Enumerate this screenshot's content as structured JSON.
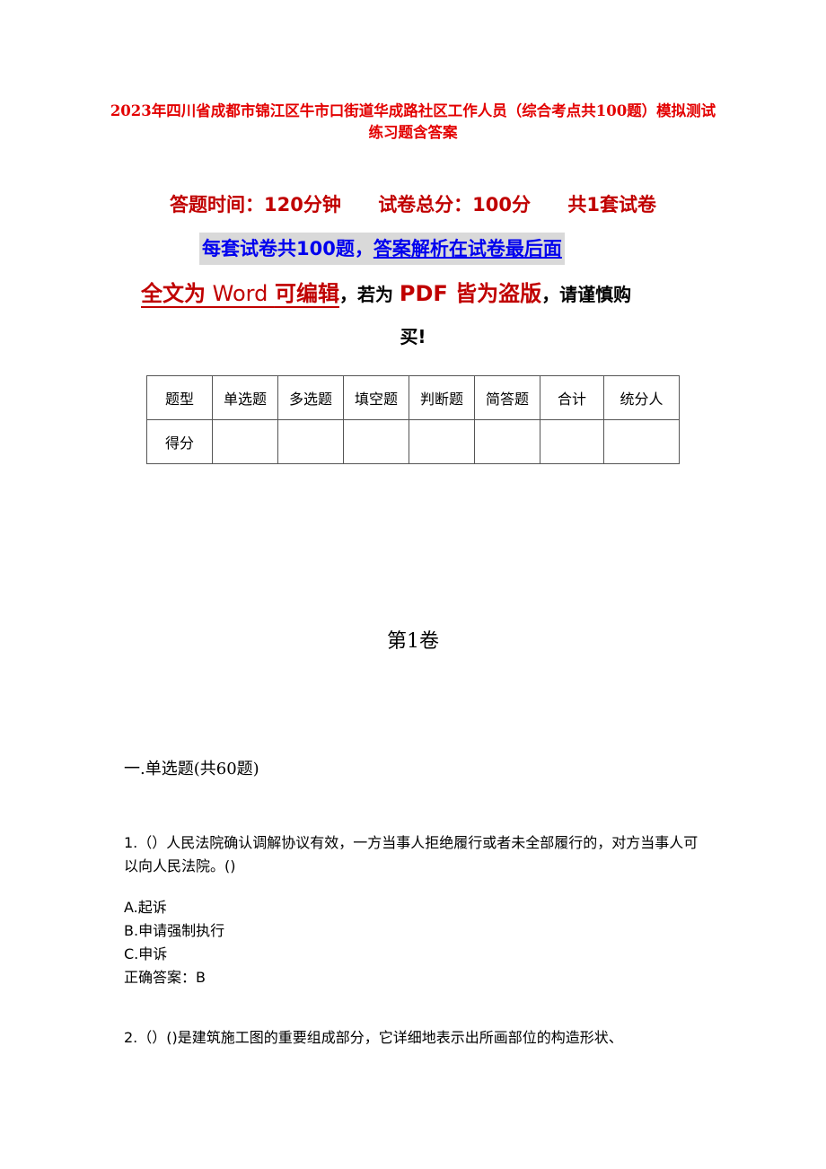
{
  "document": {
    "title": "2023年四川省成都市锦江区牛市口街道华成路社区工作人员（综合考点共100题）模拟测试练习题含答案",
    "meta": {
      "time": "答题时间：120分钟",
      "total_score": "试卷总分：100分",
      "sets": "共1套试卷"
    },
    "notice": {
      "part1": "每套试卷共100题，",
      "part2": "答案解析在试卷最后面"
    },
    "warning": {
      "part1a": "全文为",
      "part1b": " Word ",
      "part1c": "可编辑",
      "part2": "，若为 ",
      "part3": "PDF 皆为盗版",
      "part4": "，请谨慎购",
      "part5": "买!"
    },
    "score_table": {
      "header": [
        "题型",
        "单选题",
        "多选题",
        "填空题",
        "判断题",
        "简答题",
        "合计",
        "统分人"
      ],
      "row_label": "得分",
      "row_values": [
        "",
        "",
        "",
        "",
        "",
        "",
        ""
      ]
    },
    "volume_title": "第1卷",
    "section_title": "一.单选题(共60题)",
    "questions": [
      {
        "text": "1.（）人民法院确认调解协议有效，一方当事人拒绝履行或者未全部履行的，对方当事人可以向人民法院。()",
        "options": [
          "A.起诉",
          "B.申请强制执行",
          "C.申诉"
        ],
        "answer": "正确答案：B"
      },
      {
        "text": "2.（）()是建筑施工图的重要组成部分，它详细地表示出所画部位的构造形状、"
      }
    ]
  }
}
